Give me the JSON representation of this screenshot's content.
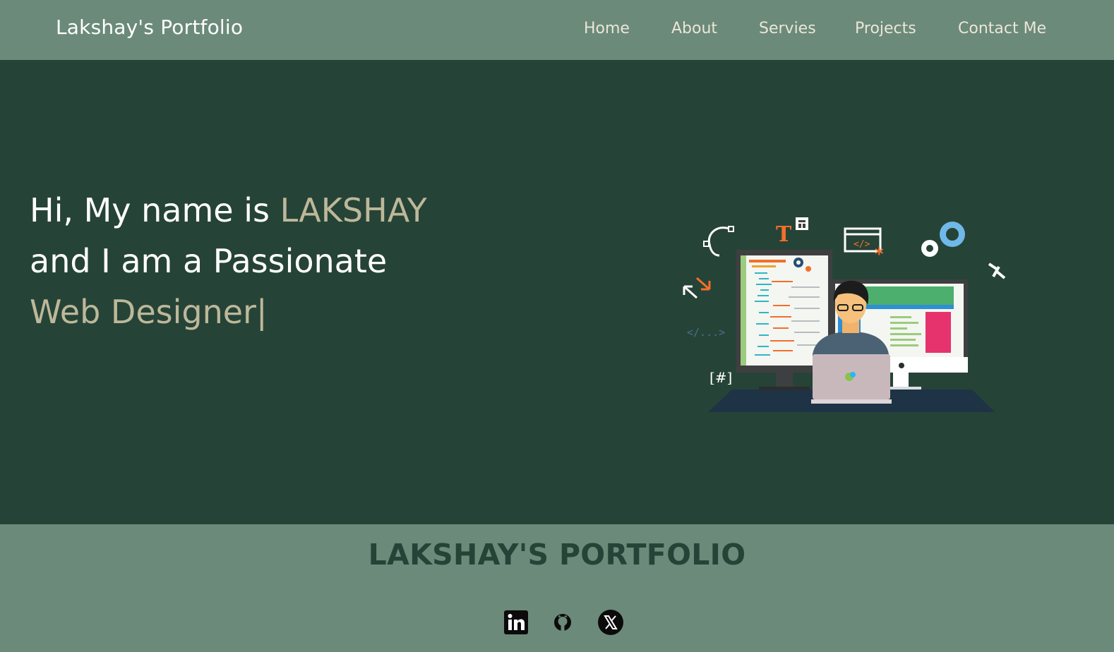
{
  "header": {
    "brand": "Lakshay's Portfolio",
    "nav": [
      {
        "label": "Home"
      },
      {
        "label": "About"
      },
      {
        "label": "Servies"
      },
      {
        "label": "Projects"
      },
      {
        "label": "Contact Me"
      }
    ]
  },
  "hero": {
    "line1_prefix": "Hi, My name is ",
    "name": "LAKSHAY",
    "line2": "and I am a Passionate",
    "role": "Web Designer",
    "cursor": "|",
    "illustration": {
      "icon": "web-developer-illustration",
      "code_tag": "</...>",
      "hash_tag": "[#]",
      "markup_tag": "</>"
    }
  },
  "footer": {
    "title": "LAKSHAY'S PORTFOLIO",
    "social": [
      {
        "name": "LinkedIn",
        "icon": "linkedin-icon"
      },
      {
        "name": "GitHub",
        "icon": "github-icon"
      },
      {
        "name": "X",
        "icon": "x-icon"
      }
    ]
  },
  "colors": {
    "nav_bg": "#6b8a7a",
    "hero_bg": "#264337",
    "accent": "#bdb89a",
    "footer_title": "#264337"
  }
}
